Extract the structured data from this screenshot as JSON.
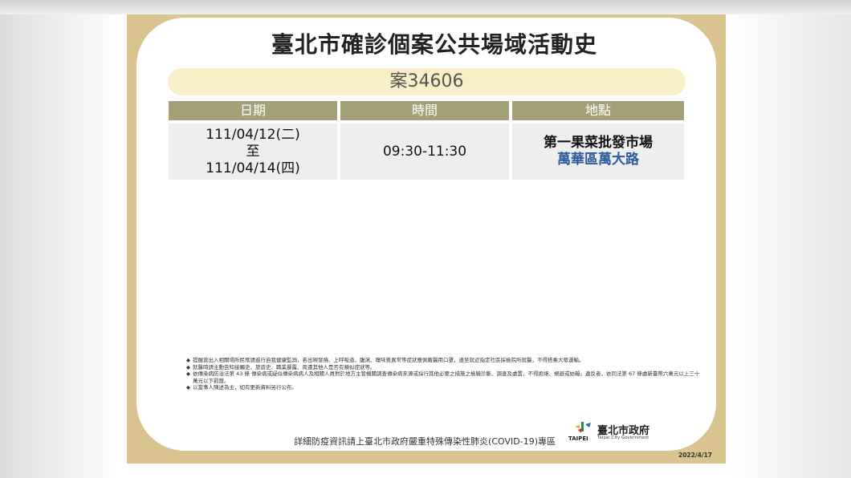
{
  "title": "臺北市確診個案公共場域活動史",
  "case_label": "案34606",
  "table": {
    "headers": [
      "日期",
      "時間",
      "地點"
    ],
    "row": {
      "date_start": "111/04/12(二)",
      "date_to": "至",
      "date_end": "111/04/14(四)",
      "time": "09:30-11:30",
      "place": "第一果菜批發市場",
      "place_address": "萬華區萬大路"
    }
  },
  "notes": [
    "提醒曾出入相關場所民眾請進行自我健康監測，若出現發燒、上呼吸道、腹瀉、嗅味覺異常等症狀應佩戴醫用口罩，速至就近指定社區採檢院所就醫，不得搭乘大眾運輸。",
    "就醫時請主動告知接觸史、旅遊史、職業暴露、周遭其他人是否有類似症狀等。",
    "依傳染病防治法第 43 條 傳染病或疑似傳染病病人及相關人員對於地方主管機關調查傳染病來源或採行其他必要之措施之檢驗診斷、調查及處置，不得拒絕、規避或妨礙。違反者，依同法第 67 條處新臺幣六萬元以上三十萬元以下罰鍰。",
    "以當事人陳述為主，如有更新資料另行公布。"
  ],
  "note_bullet": "◆",
  "footer": "詳細防疫資訊請上臺北市政府嚴重特殊傳染性肺炎(COVID-19)專區",
  "logo": {
    "org": "臺北市政府",
    "org_en": "Taipei City Government",
    "wordmark": "TAIPEI"
  },
  "date_stamp": "2022/4/17",
  "colors": {
    "frame": "#d9c48f",
    "header_cell": "#a3a07a",
    "case_pill": "#f8eec7",
    "address": "#2a5a9a"
  }
}
